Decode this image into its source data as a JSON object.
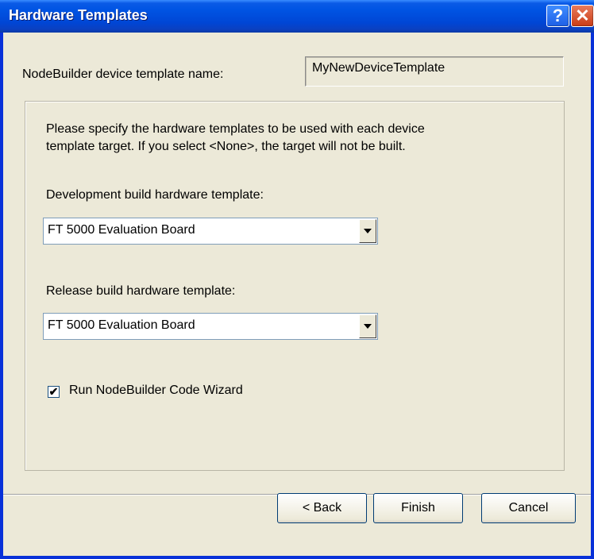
{
  "window": {
    "title": "Hardware Templates",
    "help_label": "?",
    "close_label": "✕"
  },
  "template_name": {
    "label": "NodeBuilder device template name:",
    "value": "MyNewDeviceTemplate"
  },
  "group": {
    "instructions_line1": "Please specify the hardware templates to be used with each device",
    "instructions_line2": "template target. If you select <None>, the target will not be built.",
    "dev_label": "Development build hardware template:",
    "dev_selected": "FT 5000 Evaluation Board",
    "release_label": "Release build hardware template:",
    "release_selected": "FT 5000 Evaluation Board",
    "wizard_label": "Run NodeBuilder Code Wizard",
    "wizard_checked": true
  },
  "buttons": {
    "back": "< Back",
    "finish": "Finish",
    "cancel": "Cancel"
  }
}
